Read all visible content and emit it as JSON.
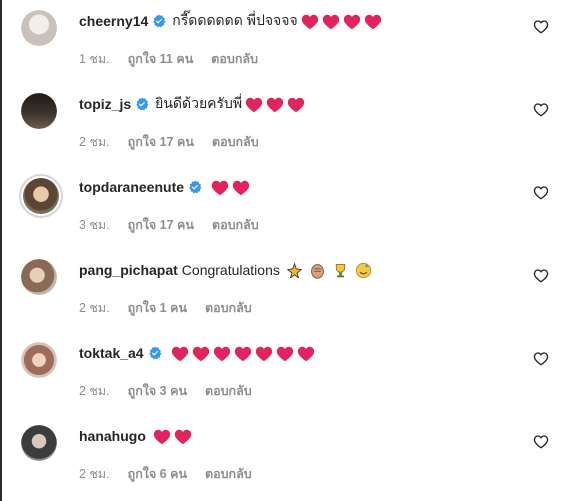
{
  "comments": [
    {
      "username": "cheerny14",
      "verified": true,
      "text": "กรี๊ดดดดดด พี่ปจจจจ",
      "hearts": 4,
      "time": "1 ชม.",
      "likes": "ถูกใจ 11 คน",
      "reply": "ตอบกลับ",
      "avatar_color": "#d9d4d0"
    },
    {
      "username": "topiz_js",
      "verified": true,
      "text": "ยินดีด้วยครับพี่",
      "hearts": 3,
      "time": "2 ชม.",
      "likes": "ถูกใจ 17 คน",
      "reply": "ตอบกลับ",
      "avatar_color": "#3a3430"
    },
    {
      "username": "topdaraneenute",
      "verified": true,
      "text": "",
      "hearts": 2,
      "time": "3 ชม.",
      "likes": "ถูกใจ 17 คน",
      "reply": "ตอบกลับ",
      "avatar_color": "#6b5a48"
    },
    {
      "username": "pang_pichapat",
      "verified": false,
      "text": "Congratulations",
      "hearts": 0,
      "emojis": [
        "raised-hands-emoji",
        "clapping-hands-emoji",
        "trophy-emoji",
        "party-face-emoji"
      ],
      "time": "2 ชม.",
      "likes": "ถูกใจ 1 คน",
      "reply": "ตอบกลับ",
      "avatar_color": "#a88a74"
    },
    {
      "username": "toktak_a4",
      "verified": true,
      "text": "",
      "hearts": 7,
      "time": "2 ชม.",
      "likes": "ถูกใจ 3 คน",
      "reply": "ตอบกลับ",
      "avatar_color": "#b58a76"
    },
    {
      "username": "hanahugo",
      "verified": false,
      "text": "",
      "hearts": 2,
      "time": "2 ชม.",
      "likes": "ถูกใจ 6 คน",
      "reply": "ตอบกลับ",
      "avatar_color": "#4d4d4d"
    }
  ],
  "colors": {
    "verified_blue": "#3897f0",
    "heart_red": "#e0245e",
    "muted": "#8e8e8e"
  }
}
